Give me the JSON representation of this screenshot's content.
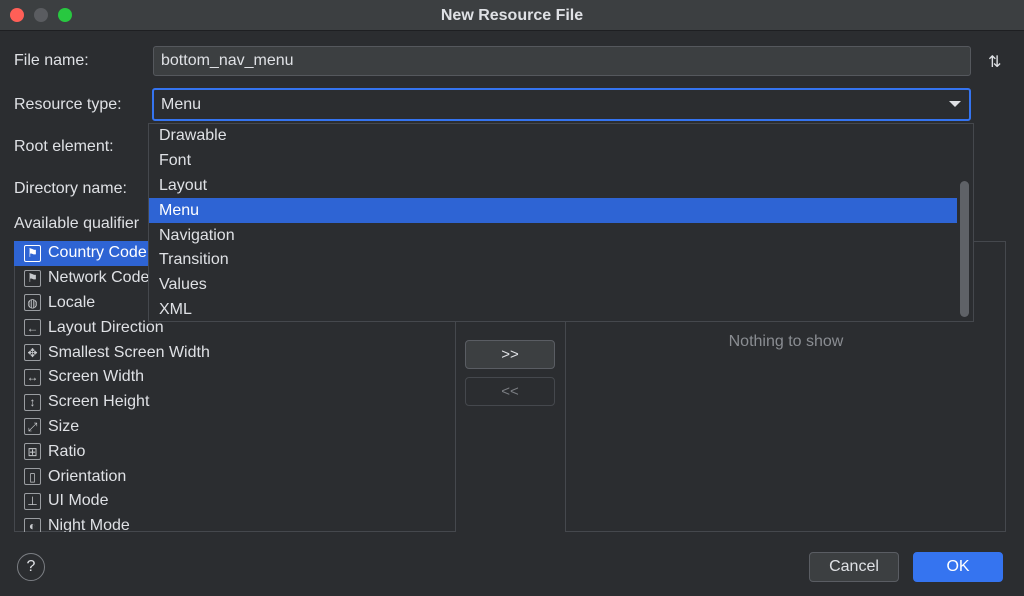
{
  "window": {
    "title": "New Resource File"
  },
  "form": {
    "file_name_label": "File name:",
    "file_name_value": "bottom_nav_menu",
    "resource_type_label": "Resource type:",
    "resource_type_value": "Menu",
    "root_element_label": "Root element:",
    "directory_name_label": "Directory name:",
    "available_qualifiers_label": "Available qualifier"
  },
  "resource_type_options": [
    {
      "label": "Drawable",
      "selected": false
    },
    {
      "label": "Font",
      "selected": false
    },
    {
      "label": "Layout",
      "selected": false
    },
    {
      "label": "Menu",
      "selected": true
    },
    {
      "label": "Navigation",
      "selected": false
    },
    {
      "label": "Transition",
      "selected": false
    },
    {
      "label": "Values",
      "selected": false
    },
    {
      "label": "XML",
      "selected": false
    }
  ],
  "qualifiers": [
    {
      "label": "Country Code",
      "icon": "country-code-icon",
      "glyph": "⚑",
      "selected": true
    },
    {
      "label": "Network Code",
      "icon": "network-code-icon",
      "glyph": "⚑",
      "selected": false
    },
    {
      "label": "Locale",
      "icon": "globe-icon",
      "glyph": "◍",
      "selected": false
    },
    {
      "label": "Layout Direction",
      "icon": "layout-direction-icon",
      "glyph": "←",
      "selected": false
    },
    {
      "label": "Smallest Screen Width",
      "icon": "smallest-screen-width-icon",
      "glyph": "✥",
      "selected": false
    },
    {
      "label": "Screen Width",
      "icon": "screen-width-icon",
      "glyph": "↔",
      "selected": false
    },
    {
      "label": "Screen Height",
      "icon": "screen-height-icon",
      "glyph": "↕",
      "selected": false
    },
    {
      "label": "Size",
      "icon": "size-icon",
      "glyph": "⤢",
      "selected": false
    },
    {
      "label": "Ratio",
      "icon": "ratio-icon",
      "glyph": "⊞",
      "selected": false
    },
    {
      "label": "Orientation",
      "icon": "orientation-icon",
      "glyph": "▯",
      "selected": false
    },
    {
      "label": "UI Mode",
      "icon": "ui-mode-icon",
      "glyph": "⊥",
      "selected": false
    },
    {
      "label": "Night Mode",
      "icon": "night-mode-icon",
      "glyph": "◐",
      "selected": false
    }
  ],
  "transfer": {
    "add_label": ">>",
    "remove_label": "<<"
  },
  "chosen_qualifiers": {
    "empty_text": "Nothing to show"
  },
  "footer": {
    "help_label": "?",
    "cancel_label": "Cancel",
    "ok_label": "OK"
  },
  "colors": {
    "accent": "#3574f0",
    "selection": "#2e64d4",
    "background": "#2b2d30"
  }
}
